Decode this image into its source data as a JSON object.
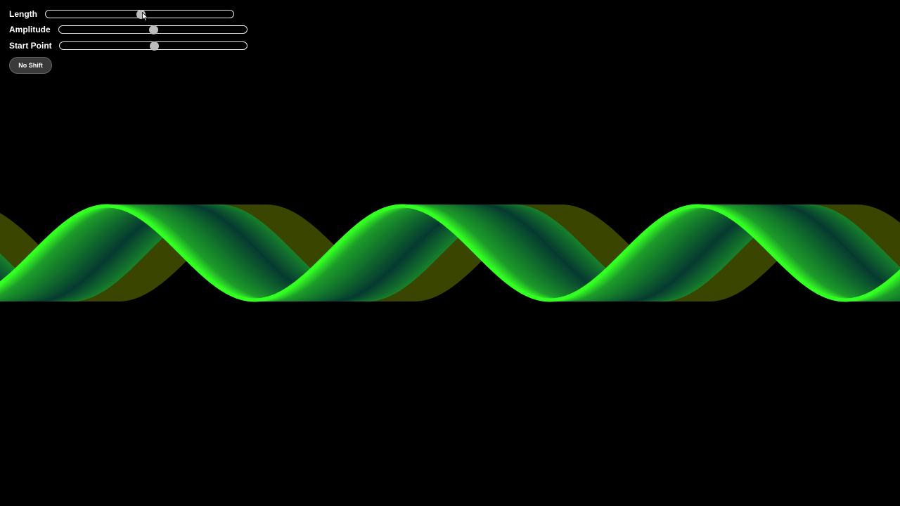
{
  "controls": {
    "length": {
      "label": "Length",
      "value_fraction": 0.505
    },
    "amplitude": {
      "label": "Amplitude",
      "value_fraction": 0.5
    },
    "start_point": {
      "label": "Start Point",
      "value_fraction": 0.5
    }
  },
  "shift_button": {
    "label": "No Shift"
  },
  "colors": {
    "background": "#000000",
    "wave_bright": "#33ff22",
    "wave_dark": "#063a30",
    "wave_shadow": "#3a4500"
  },
  "icons": {
    "cursor": "mouse-pointer-icon"
  }
}
